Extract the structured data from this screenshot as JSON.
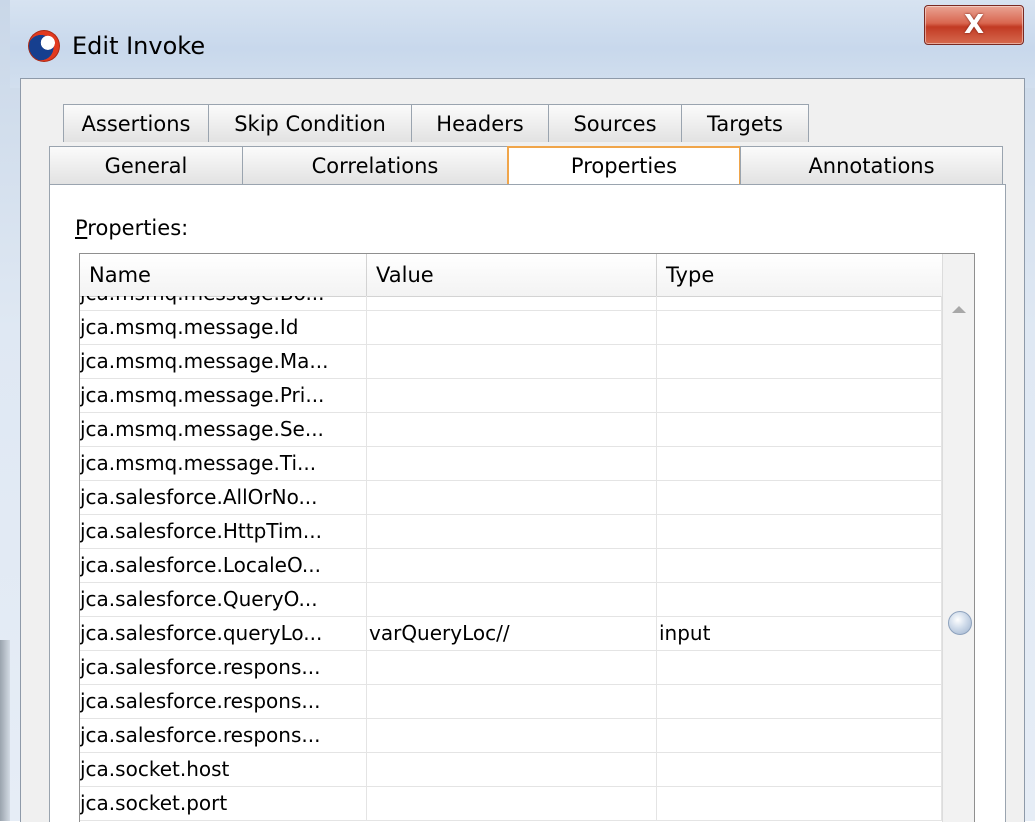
{
  "window": {
    "title": "Edit Invoke",
    "close_label": "X",
    "logo_icon": "oracle-logo-icon"
  },
  "tabs_row1": [
    "Assertions",
    "Skip Condition",
    "Headers",
    "Sources",
    "Targets"
  ],
  "tabs_row2": [
    "General",
    "Correlations",
    "Properties",
    "Annotations"
  ],
  "selected_tab": "Properties",
  "properties": {
    "label_mnemonic": "P",
    "label_rest": "roperties:",
    "columns": [
      "Name",
      "Value",
      "Type"
    ],
    "rows": [
      {
        "name": "jca.msmq.message.Bo...",
        "value": "",
        "type": ""
      },
      {
        "name": "jca.msmq.message.Id",
        "value": "",
        "type": ""
      },
      {
        "name": "jca.msmq.message.Ma...",
        "value": "",
        "type": ""
      },
      {
        "name": "jca.msmq.message.Pri...",
        "value": "",
        "type": ""
      },
      {
        "name": "jca.msmq.message.Se...",
        "value": "",
        "type": ""
      },
      {
        "name": "jca.msmq.message.Ti...",
        "value": "",
        "type": ""
      },
      {
        "name": "jca.salesforce.AllOrNo...",
        "value": "",
        "type": ""
      },
      {
        "name": "jca.salesforce.HttpTim...",
        "value": "",
        "type": ""
      },
      {
        "name": "jca.salesforce.LocaleO...",
        "value": "",
        "type": ""
      },
      {
        "name": "jca.salesforce.QueryO...",
        "value": "",
        "type": ""
      },
      {
        "name": "jca.salesforce.queryLo...",
        "value": "varQueryLoc//",
        "type": "input"
      },
      {
        "name": "jca.salesforce.respons...",
        "value": "",
        "type": ""
      },
      {
        "name": "jca.salesforce.respons...",
        "value": "",
        "type": ""
      },
      {
        "name": "jca.salesforce.respons...",
        "value": "",
        "type": ""
      },
      {
        "name": "jca.socket.host",
        "value": "",
        "type": ""
      },
      {
        "name": "jca.socket.port",
        "value": "",
        "type": ""
      }
    ]
  },
  "scrollbar": {
    "position": 0.72
  }
}
